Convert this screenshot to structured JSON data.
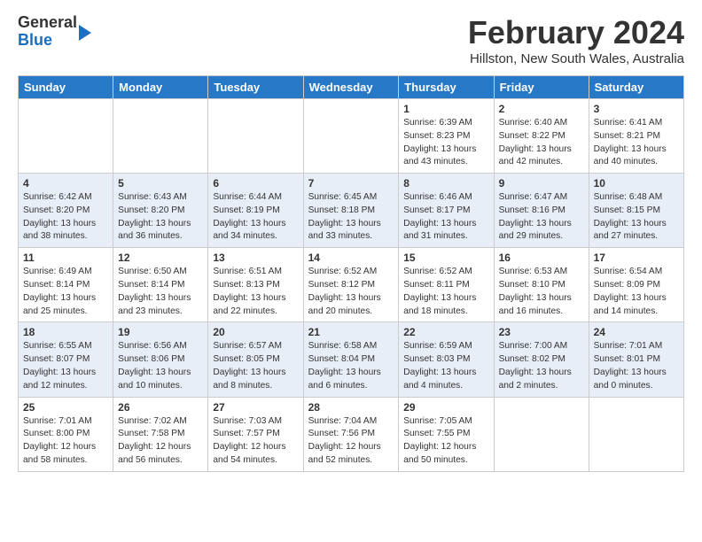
{
  "logo": {
    "general": "General",
    "blue": "Blue"
  },
  "title": "February 2024",
  "subtitle": "Hillston, New South Wales, Australia",
  "days_of_week": [
    "Sunday",
    "Monday",
    "Tuesday",
    "Wednesday",
    "Thursday",
    "Friday",
    "Saturday"
  ],
  "weeks": [
    [
      {
        "day": "",
        "info": ""
      },
      {
        "day": "",
        "info": ""
      },
      {
        "day": "",
        "info": ""
      },
      {
        "day": "",
        "info": ""
      },
      {
        "day": "1",
        "info": "Sunrise: 6:39 AM\nSunset: 8:23 PM\nDaylight: 13 hours\nand 43 minutes."
      },
      {
        "day": "2",
        "info": "Sunrise: 6:40 AM\nSunset: 8:22 PM\nDaylight: 13 hours\nand 42 minutes."
      },
      {
        "day": "3",
        "info": "Sunrise: 6:41 AM\nSunset: 8:21 PM\nDaylight: 13 hours\nand 40 minutes."
      }
    ],
    [
      {
        "day": "4",
        "info": "Sunrise: 6:42 AM\nSunset: 8:20 PM\nDaylight: 13 hours\nand 38 minutes."
      },
      {
        "day": "5",
        "info": "Sunrise: 6:43 AM\nSunset: 8:20 PM\nDaylight: 13 hours\nand 36 minutes."
      },
      {
        "day": "6",
        "info": "Sunrise: 6:44 AM\nSunset: 8:19 PM\nDaylight: 13 hours\nand 34 minutes."
      },
      {
        "day": "7",
        "info": "Sunrise: 6:45 AM\nSunset: 8:18 PM\nDaylight: 13 hours\nand 33 minutes."
      },
      {
        "day": "8",
        "info": "Sunrise: 6:46 AM\nSunset: 8:17 PM\nDaylight: 13 hours\nand 31 minutes."
      },
      {
        "day": "9",
        "info": "Sunrise: 6:47 AM\nSunset: 8:16 PM\nDaylight: 13 hours\nand 29 minutes."
      },
      {
        "day": "10",
        "info": "Sunrise: 6:48 AM\nSunset: 8:15 PM\nDaylight: 13 hours\nand 27 minutes."
      }
    ],
    [
      {
        "day": "11",
        "info": "Sunrise: 6:49 AM\nSunset: 8:14 PM\nDaylight: 13 hours\nand 25 minutes."
      },
      {
        "day": "12",
        "info": "Sunrise: 6:50 AM\nSunset: 8:14 PM\nDaylight: 13 hours\nand 23 minutes."
      },
      {
        "day": "13",
        "info": "Sunrise: 6:51 AM\nSunset: 8:13 PM\nDaylight: 13 hours\nand 22 minutes."
      },
      {
        "day": "14",
        "info": "Sunrise: 6:52 AM\nSunset: 8:12 PM\nDaylight: 13 hours\nand 20 minutes."
      },
      {
        "day": "15",
        "info": "Sunrise: 6:52 AM\nSunset: 8:11 PM\nDaylight: 13 hours\nand 18 minutes."
      },
      {
        "day": "16",
        "info": "Sunrise: 6:53 AM\nSunset: 8:10 PM\nDaylight: 13 hours\nand 16 minutes."
      },
      {
        "day": "17",
        "info": "Sunrise: 6:54 AM\nSunset: 8:09 PM\nDaylight: 13 hours\nand 14 minutes."
      }
    ],
    [
      {
        "day": "18",
        "info": "Sunrise: 6:55 AM\nSunset: 8:07 PM\nDaylight: 13 hours\nand 12 minutes."
      },
      {
        "day": "19",
        "info": "Sunrise: 6:56 AM\nSunset: 8:06 PM\nDaylight: 13 hours\nand 10 minutes."
      },
      {
        "day": "20",
        "info": "Sunrise: 6:57 AM\nSunset: 8:05 PM\nDaylight: 13 hours\nand 8 minutes."
      },
      {
        "day": "21",
        "info": "Sunrise: 6:58 AM\nSunset: 8:04 PM\nDaylight: 13 hours\nand 6 minutes."
      },
      {
        "day": "22",
        "info": "Sunrise: 6:59 AM\nSunset: 8:03 PM\nDaylight: 13 hours\nand 4 minutes."
      },
      {
        "day": "23",
        "info": "Sunrise: 7:00 AM\nSunset: 8:02 PM\nDaylight: 13 hours\nand 2 minutes."
      },
      {
        "day": "24",
        "info": "Sunrise: 7:01 AM\nSunset: 8:01 PM\nDaylight: 13 hours\nand 0 minutes."
      }
    ],
    [
      {
        "day": "25",
        "info": "Sunrise: 7:01 AM\nSunset: 8:00 PM\nDaylight: 12 hours\nand 58 minutes."
      },
      {
        "day": "26",
        "info": "Sunrise: 7:02 AM\nSunset: 7:58 PM\nDaylight: 12 hours\nand 56 minutes."
      },
      {
        "day": "27",
        "info": "Sunrise: 7:03 AM\nSunset: 7:57 PM\nDaylight: 12 hours\nand 54 minutes."
      },
      {
        "day": "28",
        "info": "Sunrise: 7:04 AM\nSunset: 7:56 PM\nDaylight: 12 hours\nand 52 minutes."
      },
      {
        "day": "29",
        "info": "Sunrise: 7:05 AM\nSunset: 7:55 PM\nDaylight: 12 hours\nand 50 minutes."
      },
      {
        "day": "",
        "info": ""
      },
      {
        "day": "",
        "info": ""
      }
    ]
  ]
}
